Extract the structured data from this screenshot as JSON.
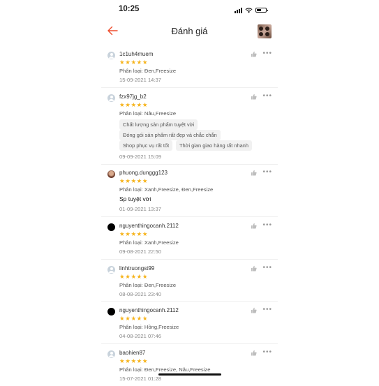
{
  "status": {
    "time": "10:25"
  },
  "header": {
    "title": "Đánh giá",
    "back_icon": "back-arrow-icon",
    "thumb_icon": "product-thumbnail"
  },
  "stars": "★★★★★",
  "colors": {
    "accent": "#ee4d2d",
    "star": "#f6b31a"
  },
  "reviews": [
    {
      "username": "1c1uh4muem",
      "variant": "Phân loại: Đen,Freesize",
      "date": "15-09-2021 14:37"
    },
    {
      "username": "fzx97jg_b2",
      "variant": "Phân loại: Nâu,Freesize",
      "tags": [
        "Chất lượng sản phẩm tuyệt vời",
        "Đóng gói sản phẩm rất đẹp và chắc chắn",
        "Shop phục vụ rất tốt",
        "Thời gian giao hàng rất nhanh"
      ],
      "date": "09-09-2021 15:09"
    },
    {
      "username": "phuong.dunggg123",
      "variant": "Phân loại: Xanh,Freesize, Đen,Freesize",
      "comment": "Sp tuyệt vời",
      "date": "01-09-2021 13:37"
    },
    {
      "username": "nguyenthingocanh.2112",
      "variant": "Phân loại: Xanh,Freesize",
      "date": "09-08-2021 22:50"
    },
    {
      "username": "linhtruongst99",
      "variant": "Phân loại: Đen,Freesize",
      "date": "08-08-2021 23:40"
    },
    {
      "username": "nguyenthingocanh.2112",
      "variant": "Phân loại: Hồng,Freesize",
      "date": "04-08-2021 07:46"
    },
    {
      "username": "baohien87",
      "variant": "Phân loại: Đen,Freesize, Nâu,Freesize",
      "date": "15-07-2021 01:28"
    }
  ]
}
